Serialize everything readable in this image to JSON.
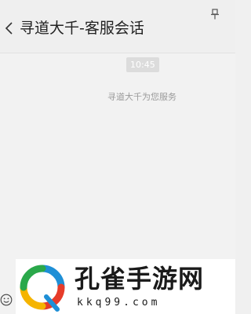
{
  "header": {
    "back_icon": "chevron-left-icon",
    "title": "寻道大千-客服会话",
    "pin_icon": "pin-icon"
  },
  "chat": {
    "timestamp": "10:45",
    "system_message": "寻道大千为您服务"
  },
  "footer": {
    "emoji_icon": "smiley-icon"
  },
  "watermark": {
    "name": "孔雀手游网",
    "domain": "kkq99.com"
  },
  "colors": {
    "header_background": "#efefef",
    "chat_background": "#f2f2f2",
    "timestamp_badge": "#dcdcdc",
    "notice_text": "#9a9a9a",
    "logo_blue": "#1e8fd6",
    "logo_red": "#e63c2a",
    "logo_yellow": "#f5b400",
    "logo_green": "#2aa84a"
  }
}
